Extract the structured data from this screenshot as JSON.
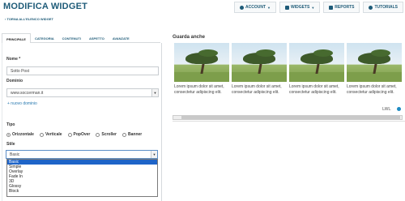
{
  "header": {
    "title": "MODIFICA WIDGET",
    "nav": [
      {
        "label": "ACCOUNT",
        "icon": "user-icon",
        "caret": true
      },
      {
        "label": "WIDGETS",
        "icon": "grid-icon",
        "caret": true
      },
      {
        "label": "REPORTS",
        "icon": "chart-icon",
        "caret": false
      },
      {
        "label": "TUTORIALS",
        "icon": "help-icon",
        "caret": false
      }
    ]
  },
  "back_link": "‹ TORNA ALL'ELENCO WIDGET",
  "tabs": [
    {
      "label": "PRINCIPALE",
      "active": true
    },
    {
      "label": "CATEGORIA",
      "active": false
    },
    {
      "label": "CONTENUTI",
      "active": false
    },
    {
      "label": "ASPETTO",
      "active": false
    },
    {
      "label": "AVANZATE",
      "active": false
    }
  ],
  "form": {
    "name_label": "Nome *",
    "name_value": "Sotto Post",
    "domain_label": "Dominio",
    "domain_value": "www.soccerman.it",
    "new_domain_link": "+ nuovo dominio",
    "type_label": "Tipo",
    "type_options": [
      {
        "label": "Orizzontale",
        "checked": true
      },
      {
        "label": "Verticale",
        "checked": false
      },
      {
        "label": "PopOver",
        "checked": false
      },
      {
        "label": "Scroller",
        "checked": false
      },
      {
        "label": "Banner",
        "checked": false
      }
    ],
    "style_label": "Stile",
    "style_value": "Basic",
    "style_options": [
      "Basic",
      "Simple",
      "Overlay",
      "Fade In",
      "3D",
      "Glossy",
      "Block"
    ],
    "style_selected_index": 0
  },
  "preview": {
    "title": "Guarda anche",
    "cards": [
      {
        "text": "Lorem ipsum dolor sit amet, consectetur adipiscing elit."
      },
      {
        "text": "Lorem ipsum dolor sit amet, consectetur adipiscing elit."
      },
      {
        "text": "Lorem ipsum dolor sit amet, consectetur adipiscing elit."
      },
      {
        "text": "Lorem ipsum dolor sit amet, consectetur adipiscing elit."
      }
    ],
    "brand": "LWL"
  }
}
